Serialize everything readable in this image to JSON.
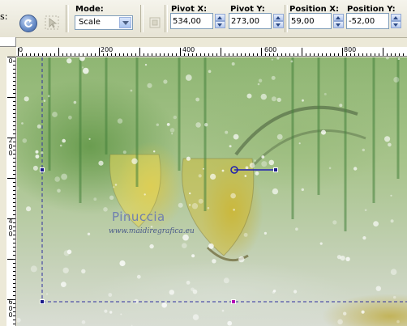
{
  "toolbar": {
    "edge_text": "s:",
    "mode_label": "Mode:",
    "mode_value": "Scale",
    "pivot_x_label": "Pivot X:",
    "pivot_x_value": "534,00",
    "pivot_y_label": "Pivot Y:",
    "pivot_y_value": "273,00",
    "position_x_label": "Position X:",
    "position_x_value": "59,00",
    "position_y_label": "Position Y:",
    "position_y_value": "-52,00"
  },
  "ruler_h": [
    "0",
    "200",
    "400",
    "600",
    "800"
  ],
  "ruler_v": [
    "0",
    "200",
    "400",
    "600"
  ],
  "canvas": {
    "watermark_name": "Pinuccia",
    "watermark_url": "www.maidiregrafica.eu"
  },
  "icons": {
    "round_button": "reset-arrow-icon",
    "tool_a": "select-cursor-icon",
    "tool_b": "rotate-square-icon"
  },
  "colors": {
    "handle": "#1a1a8a",
    "pivot_line": "#3030a0",
    "selection_handle": "#b400b4"
  }
}
